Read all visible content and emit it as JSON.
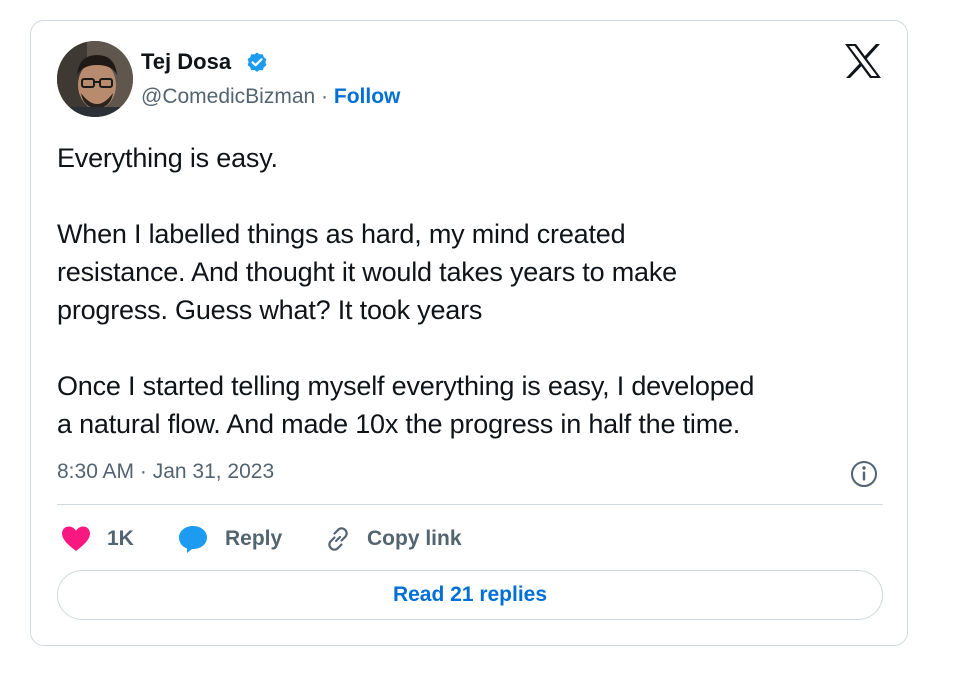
{
  "author": {
    "name": "Tej Dosa",
    "handle": "@ComedicBizman",
    "separator": " · ",
    "follow_label": "Follow",
    "verified": true
  },
  "tweet": {
    "text": "Everything is easy.\n\nWhen I labelled things as hard, my mind created\nresistance. And thought it would takes years to make\nprogress. Guess what? It took years\n\nOnce I started telling myself everything is easy, I developed\na natural flow. And made 10x the progress in half the time.",
    "timestamp": "8:30 AM · Jan 31, 2023"
  },
  "actions": {
    "likes_count": "1K",
    "reply_label": "Reply",
    "copy_link_label": "Copy link",
    "read_replies_label": "Read 21 replies"
  },
  "icons": {
    "logo": "x-logo-icon",
    "verified": "verified-badge-icon",
    "info": "info-icon",
    "like": "heart-icon",
    "reply": "speech-bubble-icon",
    "copy_link": "link-icon"
  },
  "colors": {
    "link_blue": "#006fd6",
    "verified_blue": "#1d9bf0",
    "like_pink": "#f91880",
    "text_primary": "#0f1419",
    "text_secondary": "#536471",
    "border": "#cfd9de"
  }
}
